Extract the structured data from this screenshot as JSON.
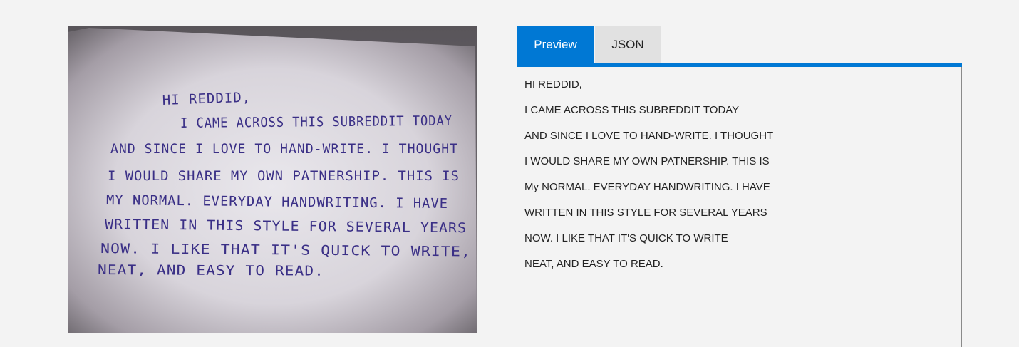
{
  "photo": {
    "handwritten_lines": [
      "HI REDDID,",
      "I CAME ACROSS THIS SUBREDDIT TODAY",
      "AND SINCE I LOVE TO HAND-WRITE. I THOUGHT",
      "I WOULD SHARE MY OWN PATNERSHIP. THIS IS",
      "MY NORMAL. EVERYDAY HANDWRITING. I HAVE",
      "WRITTEN IN THIS STYLE FOR SEVERAL YEARS",
      "NOW. I LIKE THAT IT'S QUICK TO WRITE,",
      "NEAT, AND EASY TO READ."
    ]
  },
  "tabs": {
    "preview_label": "Preview",
    "json_label": "JSON",
    "active": "Preview"
  },
  "preview": {
    "lines": [
      "HI REDDID,",
      "I CAME ACROSS THIS SUBREDDIT TODAY",
      "AND SINCE I LOVE TO HAND-WRITE. I THOUGHT",
      "I WOULD SHARE MY OWN PATNERSHIP. THIS IS",
      "My NORMAL. EVERYDAY HANDWRITING. I HAVE",
      "WRITTEN IN THIS STYLE FOR SEVERAL YEARS",
      "NOW. I LIKE THAT IT'S QUICK TO WRITE",
      "NEAT, AND EASY TO READ."
    ]
  },
  "colors": {
    "accent": "#0078d4",
    "ink": "#3a2f86",
    "background": "#f3f3f3"
  }
}
